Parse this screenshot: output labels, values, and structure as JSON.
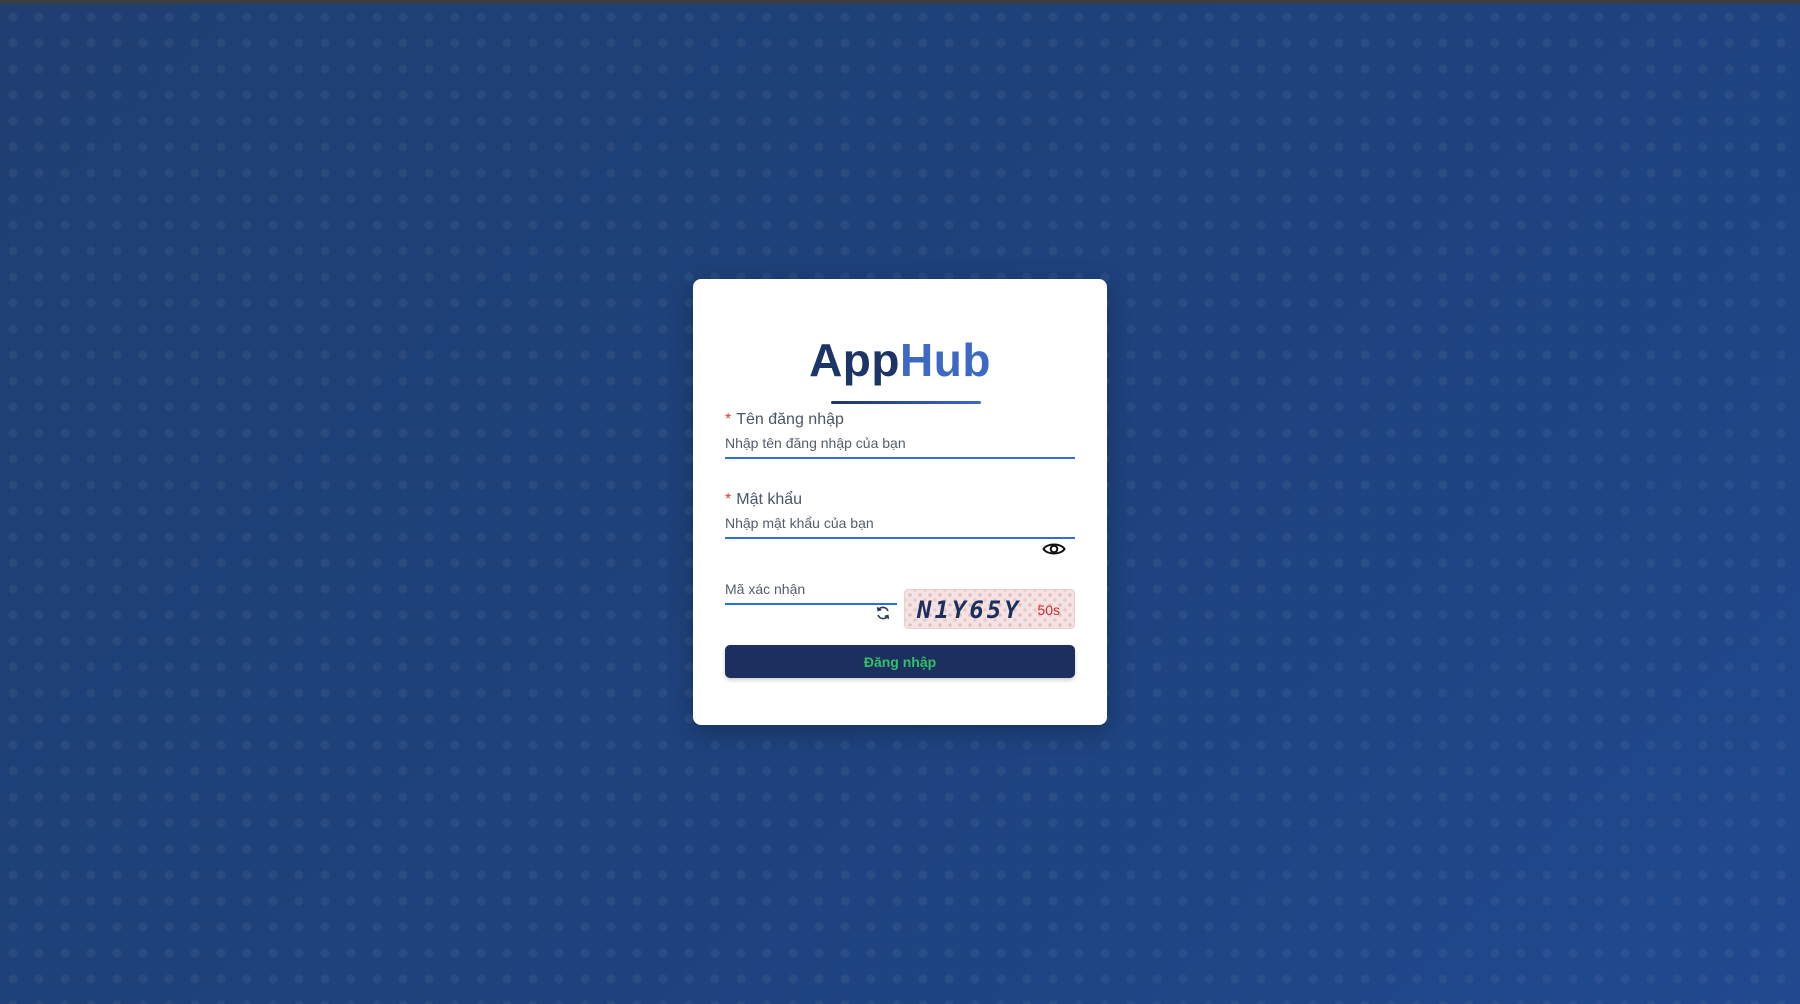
{
  "app": {
    "logo_part_a": "App",
    "logo_part_b": "Hub"
  },
  "form": {
    "required_mark": "*",
    "username": {
      "label": "Tên đăng nhập",
      "placeholder": "Nhập tên đăng nhập của bạn",
      "value": ""
    },
    "password": {
      "label": "Mật khẩu",
      "placeholder": "Nhập mật khẩu của bạn",
      "value": "",
      "toggle_icon": "eye-icon"
    },
    "captcha": {
      "placeholder": "Mã xác nhận",
      "value": "",
      "refresh_icon": "refresh-icon",
      "code": "N1Y65Y",
      "timer": "50s"
    },
    "submit_label": "Đăng nhập"
  },
  "colors": {
    "brand_dark": "#1c3566",
    "brand_light": "#3d68c4",
    "input_underline": "#2a6fdb",
    "required": "#e03a3a",
    "button_bg": "#1c2f5e",
    "button_text": "#2fc06a",
    "timer": "#d12a2a"
  }
}
